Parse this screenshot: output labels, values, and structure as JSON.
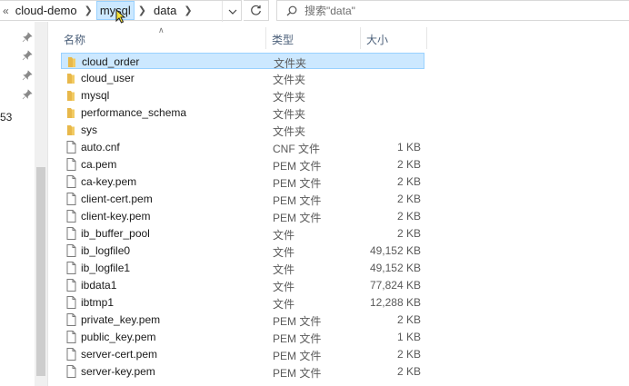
{
  "addressbar": {
    "lead": "«",
    "crumbs": [
      "cloud-demo",
      "mysql",
      "data"
    ]
  },
  "search": {
    "placeholder": "搜索\"data\""
  },
  "nav": {
    "partial_number": "53"
  },
  "columns": {
    "name": "名称",
    "type": "类型",
    "size": "大小"
  },
  "files": [
    {
      "name": "cloud_order",
      "type": "文件夹",
      "size": "",
      "kind": "folder",
      "selected": true
    },
    {
      "name": "cloud_user",
      "type": "文件夹",
      "size": "",
      "kind": "folder"
    },
    {
      "name": "mysql",
      "type": "文件夹",
      "size": "",
      "kind": "folder"
    },
    {
      "name": "performance_schema",
      "type": "文件夹",
      "size": "",
      "kind": "folder"
    },
    {
      "name": "sys",
      "type": "文件夹",
      "size": "",
      "kind": "folder"
    },
    {
      "name": "auto.cnf",
      "type": "CNF 文件",
      "size": "1 KB",
      "kind": "file"
    },
    {
      "name": "ca.pem",
      "type": "PEM 文件",
      "size": "2 KB",
      "kind": "file"
    },
    {
      "name": "ca-key.pem",
      "type": "PEM 文件",
      "size": "2 KB",
      "kind": "file"
    },
    {
      "name": "client-cert.pem",
      "type": "PEM 文件",
      "size": "2 KB",
      "kind": "file"
    },
    {
      "name": "client-key.pem",
      "type": "PEM 文件",
      "size": "2 KB",
      "kind": "file"
    },
    {
      "name": "ib_buffer_pool",
      "type": "文件",
      "size": "2 KB",
      "kind": "file"
    },
    {
      "name": "ib_logfile0",
      "type": "文件",
      "size": "49,152 KB",
      "kind": "file"
    },
    {
      "name": "ib_logfile1",
      "type": "文件",
      "size": "49,152 KB",
      "kind": "file"
    },
    {
      "name": "ibdata1",
      "type": "文件",
      "size": "77,824 KB",
      "kind": "file"
    },
    {
      "name": "ibtmp1",
      "type": "文件",
      "size": "12,288 KB",
      "kind": "file"
    },
    {
      "name": "private_key.pem",
      "type": "PEM 文件",
      "size": "2 KB",
      "kind": "file"
    },
    {
      "name": "public_key.pem",
      "type": "PEM 文件",
      "size": "1 KB",
      "kind": "file"
    },
    {
      "name": "server-cert.pem",
      "type": "PEM 文件",
      "size": "2 KB",
      "kind": "file"
    },
    {
      "name": "server-key.pem",
      "type": "PEM 文件",
      "size": "2 KB",
      "kind": "file"
    }
  ],
  "colors": {
    "selection": "#cce8ff",
    "selection_border": "#99d1ff",
    "folder": "#e8b84a"
  }
}
